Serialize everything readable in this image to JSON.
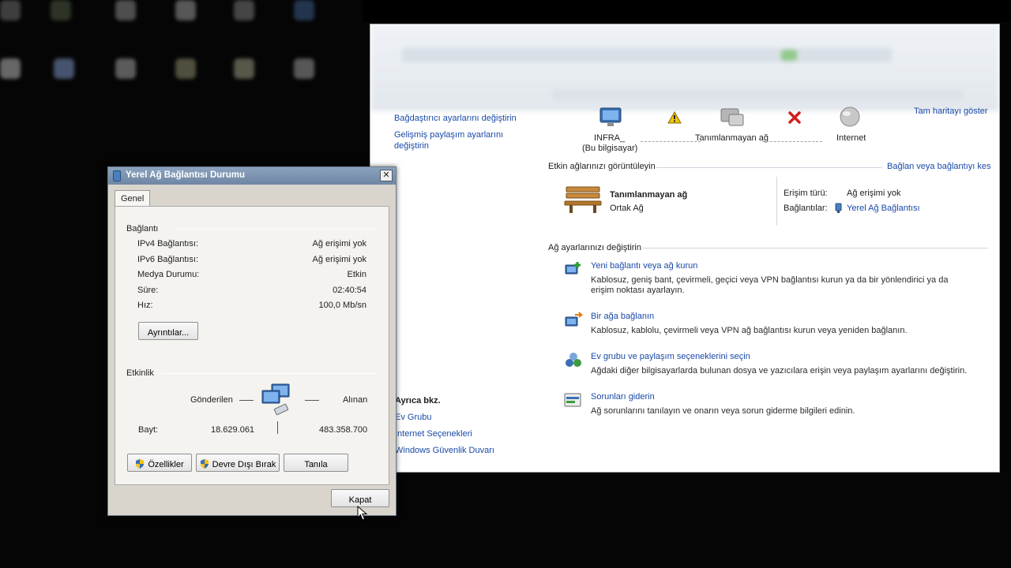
{
  "nsc": {
    "sidebar_links": [
      "Bağdaştırıcı ayarlarını değiştirin",
      "Gelişmiş paylaşım ayarlarını",
      "değiştirin"
    ],
    "top_right_link": "Tam haritayı göster",
    "map": {
      "computer_name": "INFRA_",
      "computer_sub": "(Bu bilgisayar)",
      "network_label": "Tanımlanmayan ağ",
      "internet_label": "Internet"
    },
    "active_networks_header": "Etkin ağlarınızı görüntüleyin",
    "connect_link": "Bağlan veya bağlantıyı kes",
    "network_name": "Tanımlanmayan ağ",
    "network_type": "Ortak Ağ",
    "access_type_label": "Erişim türü:",
    "access_type_value": "Ağ erişimi yok",
    "connections_label": "Bağlantılar:",
    "connections_value": "Yerel Ağ Bağlantısı",
    "change_settings_header": "Ağ ayarlarınızı değiştirin",
    "actions": [
      {
        "title": "Yeni bağlantı veya ağ kurun",
        "desc": "Kablosuz, geniş bant, çevirmeli, geçici veya VPN bağlantısı kurun ya da bir yönlendirici ya da erişim noktası ayarlayın."
      },
      {
        "title": "Bir ağa bağlanın",
        "desc": "Kablosuz, kablolu, çevirmeli veya VPN ağ bağlantısı kurun veya yeniden bağlanın."
      },
      {
        "title": "Ev grubu ve paylaşım seçeneklerini seçin",
        "desc": "Ağdaki diğer bilgisayarlarda bulunan dosya ve yazıcılara erişin veya paylaşım ayarlarını değiştirin."
      },
      {
        "title": "Sorunları giderin",
        "desc": "Ağ sorunlarını tanılayın ve onarın veya sorun giderme bilgileri edinin."
      }
    ],
    "see_also_header": "Ayrıca bkz.",
    "see_also": [
      "Ev Grubu",
      "Internet Seçenekleri",
      "Windows Güvenlik Duvarı"
    ]
  },
  "dialog": {
    "title": "Yerel Ağ Bağlantısı Durumu",
    "close": "✕",
    "tab": "Genel",
    "connection_group": "Bağlantı",
    "rows": [
      {
        "label": "IPv4 Bağlantısı:",
        "value": "Ağ erişimi yok"
      },
      {
        "label": "IPv6 Bağlantısı:",
        "value": "Ağ erişimi yok"
      },
      {
        "label": "Medya Durumu:",
        "value": "Etkin"
      },
      {
        "label": "Süre:",
        "value": "02:40:54"
      },
      {
        "label": "Hız:",
        "value": "100,0 Mb/sn"
      }
    ],
    "details_button": "Ayrıntılar...",
    "activity_group": "Etkinlik",
    "sent_label": "Gönderilen",
    "received_label": "Alınan",
    "bytes_label": "Bayt:",
    "bytes_sent": "18.629.061",
    "bytes_received": "483.358.700",
    "properties_button": "Özellikler",
    "disable_button": "Devre Dışı Bırak",
    "diagnose_button": "Tanıla",
    "close_button": "Kapat"
  }
}
